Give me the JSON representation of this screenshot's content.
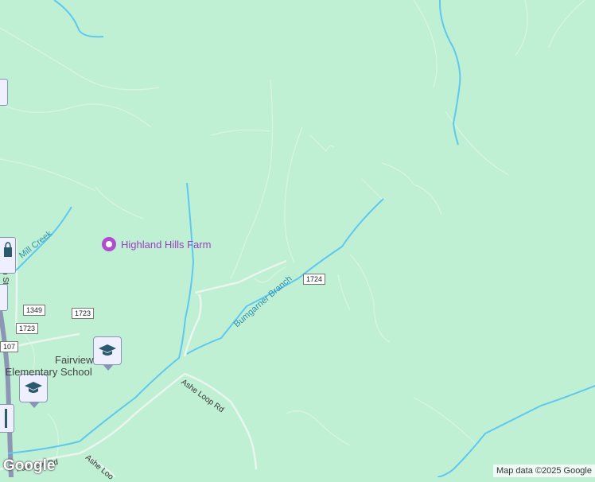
{
  "map": {
    "poi": {
      "label": "Highland Hills Farm",
      "icon": "camera-icon"
    },
    "school": {
      "label_line1": "Fairview",
      "label_line2": "Elementary School",
      "icon": "graduation-cap-icon"
    },
    "waterways": {
      "mill_creek": "Mill Creek",
      "bumgarner": "Bumgarner Branch"
    },
    "roads": {
      "ashe_loop": "Ashe Loop Rd",
      "ashe_loop_2": "Ashe Loo",
      "fairview": "Fairview Rd",
      "street_partial": "n St"
    },
    "shields": [
      "1724",
      "1349",
      "1723",
      "1723",
      "107"
    ],
    "branding": {
      "logo": "Google",
      "attribution": "Map data ©2025 Google"
    },
    "colors": {
      "land": "#bff0d4",
      "water": "#5ec8f0",
      "trail": "#e8f3ec",
      "poi": "#9a3fc0"
    }
  }
}
